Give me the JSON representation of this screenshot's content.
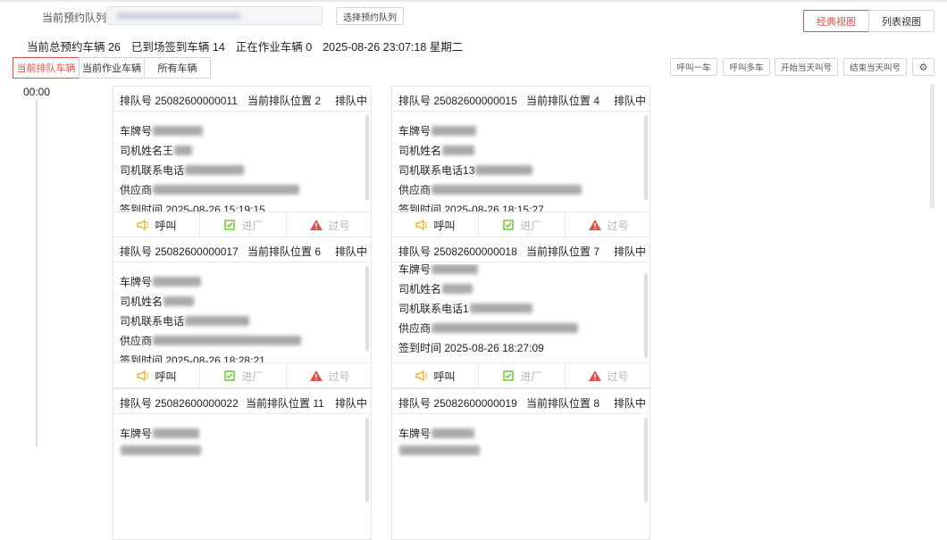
{
  "header": {
    "queue_label": "当前预约队列",
    "choose_queue_btn": "选择预约队列",
    "view_classic": "经典视图",
    "view_list": "列表视图"
  },
  "stats": {
    "total": "当前总预约车辆 26",
    "arrived": "已到场签到车辆 14",
    "working": "正在作业车辆 0",
    "datetime": "2025-08-26 23:07:18 星期二"
  },
  "tabs": [
    "当前排队车辆",
    "当前作业车辆",
    "所有车辆"
  ],
  "actions": [
    "呼叫一车",
    "呼叫多车",
    "开始当天叫号",
    "结束当天叫号",
    "⚙"
  ],
  "timeline": {
    "time": "00:00"
  },
  "card_labels": {
    "plate": "车牌号",
    "driver": "司机姓名",
    "phone": "司机联系电话",
    "supplier": "供应商",
    "checkin": "签到时间",
    "call": "呼叫",
    "enter": "进厂",
    "pass": "过号"
  },
  "cards": [
    {
      "queue_no": "排队号 25082600000011",
      "position": "当前排队位置 2",
      "status": "排队中",
      "driver_prefix": "王",
      "phone_prefix": "",
      "supplier_prefix": "",
      "plate_prefix": "",
      "checkin": "2025-08-26 15:19:15"
    },
    {
      "queue_no": "排队号 25082600000015",
      "position": "当前排队位置 4",
      "status": "排队中",
      "driver_prefix": "",
      "phone_prefix": "13",
      "supplier_prefix": "",
      "plate_prefix": "",
      "checkin": "2025-08-26 18:15:27"
    },
    {
      "queue_no": "排队号 25082600000017",
      "position": "当前排队位置 6",
      "status": "排队中",
      "driver_prefix": "",
      "phone_prefix": "",
      "supplier_prefix": "",
      "plate_prefix": "",
      "checkin": "2025-08-26 18:28:21"
    },
    {
      "queue_no": "排队号 25082600000018",
      "position": "当前排队位置 7",
      "status": "排队中",
      "driver_prefix": "",
      "phone_prefix": "1",
      "supplier_prefix": "",
      "plate_prefix": "",
      "checkin": "2025-08-26 18:27:09"
    },
    {
      "queue_no": "排队号 25082600000022",
      "position": "当前排队位置 11",
      "status": "排队中",
      "driver_prefix": "",
      "phone_prefix": "",
      "supplier_prefix": "",
      "plate_prefix": "",
      "checkin": ""
    },
    {
      "queue_no": "排队号 25082600000019",
      "position": "当前排队位置 8",
      "status": "排队中",
      "driver_prefix": "",
      "phone_prefix": "",
      "supplier_prefix": "",
      "plate_prefix": "",
      "checkin": ""
    }
  ],
  "colors": {
    "accent": "#e0534a",
    "call_icon": "#f0b429",
    "enter_icon": "#52c41a",
    "pass_icon": "#e0534a"
  }
}
